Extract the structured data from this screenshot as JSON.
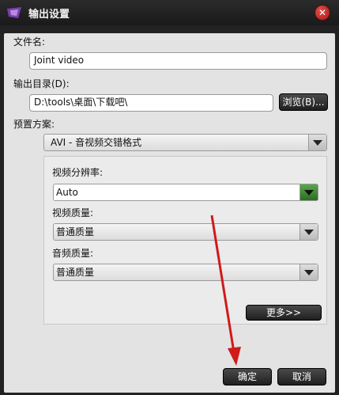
{
  "window": {
    "title": "输出设置"
  },
  "file_name": {
    "label": "文件名:",
    "value": "Joint video"
  },
  "output_dir": {
    "label": "输出目录(D):",
    "value": "D:\\tools\\桌面\\下载吧\\",
    "browse_label": "浏览(B)..."
  },
  "preset": {
    "label": "预置方案:",
    "selected": "AVI - 音视频交错格式"
  },
  "video_resolution": {
    "label": "视频分辨率:",
    "selected": "Auto"
  },
  "video_quality": {
    "label": "视频质量:",
    "selected": "普通质量"
  },
  "audio_quality": {
    "label": "音频质量:",
    "selected": "普通质量"
  },
  "more_label": "更多>>",
  "ok_label": "确定",
  "cancel_label": "取消",
  "annotation": {
    "arrow_color": "#d11a1a"
  }
}
